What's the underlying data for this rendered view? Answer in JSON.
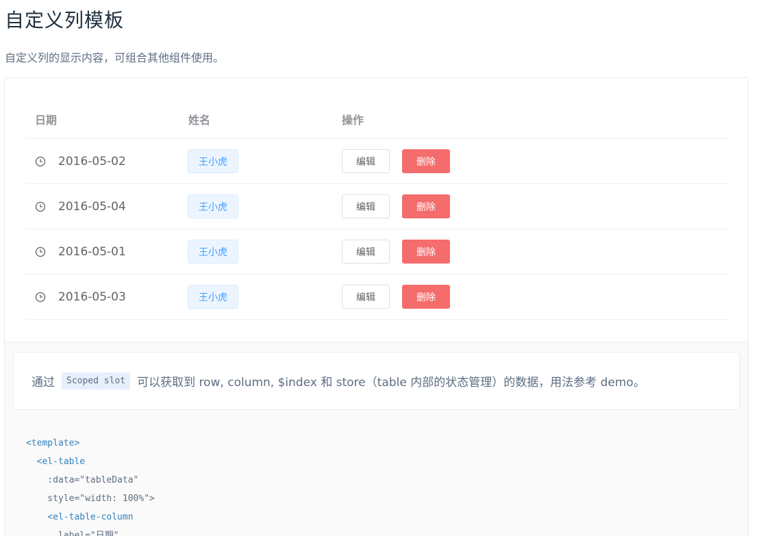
{
  "header": {
    "title": "自定义列模板",
    "description": "自定义列的显示内容，可组合其他组件使用。"
  },
  "table": {
    "columns": [
      "日期",
      "姓名",
      "操作"
    ],
    "rows": [
      {
        "date": "2016-05-02",
        "name": "王小虎",
        "edit": "编辑",
        "delete": "删除"
      },
      {
        "date": "2016-05-04",
        "name": "王小虎",
        "edit": "编辑",
        "delete": "删除"
      },
      {
        "date": "2016-05-01",
        "name": "王小虎",
        "edit": "编辑",
        "delete": "删除"
      },
      {
        "date": "2016-05-03",
        "name": "王小虎",
        "edit": "编辑",
        "delete": "删除"
      }
    ]
  },
  "tip": {
    "prefix": "通过",
    "code": "Scoped slot",
    "suffix": "可以获取到 row, column, $index 和 store（table 内部的状态管理）的数据，用法参考 demo。"
  },
  "code": {
    "line1": "<template>",
    "line2": "  <el-table",
    "line3_attr": "    :data=",
    "line3_val": "\"tableData\"",
    "line4_attr": "    style=",
    "line4_val": "\"width: 100%\">",
    "line5": "    <el-table-column",
    "line6_attr": "      label=",
    "line6_val": "\"日期\""
  },
  "colors": {
    "primary": "#409eff",
    "danger": "#f56c6c"
  }
}
